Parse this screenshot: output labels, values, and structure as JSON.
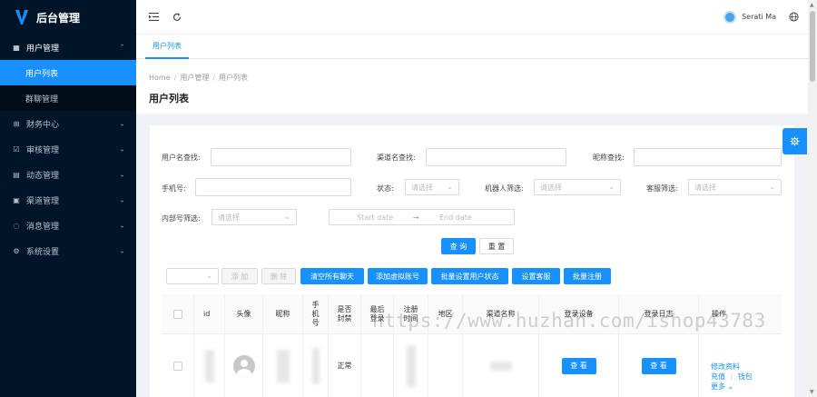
{
  "app": {
    "title": "后台管理"
  },
  "sidebar": {
    "items": [
      {
        "label": "用户管理",
        "icon": "table-icon",
        "open": true,
        "children": [
          {
            "label": "用户列表",
            "active": true
          },
          {
            "label": "群聊管理",
            "active": false
          }
        ]
      },
      {
        "label": "财务中心",
        "icon": "finance-icon"
      },
      {
        "label": "审核管理",
        "icon": "check-icon"
      },
      {
        "label": "动态管理",
        "icon": "feed-icon"
      },
      {
        "label": "渠道管理",
        "icon": "channel-icon"
      },
      {
        "label": "消息管理",
        "icon": "message-icon"
      },
      {
        "label": "系统设置",
        "icon": "gear-icon"
      }
    ]
  },
  "header": {
    "user_name": "Serati Ma"
  },
  "tabs": [
    {
      "label": "用户列表",
      "active": true
    }
  ],
  "breadcrumb": [
    "Home",
    "用户管理",
    "用户列表"
  ],
  "page": {
    "title": "用户列表"
  },
  "filters": {
    "username_label": "用户名查找:",
    "channel_label": "渠道名查找:",
    "nickname_label": "昵称查找:",
    "phone_label": "手机号:",
    "status_label": "状态:",
    "status_placeholder": "请选择",
    "robot_label": "机器人筛选:",
    "robot_placeholder": "请选择",
    "service_label": "客服筛选:",
    "service_placeholder": "请选择",
    "internal_label": "内部号筛选:",
    "internal_placeholder": "请选择",
    "date_start": "Start date",
    "date_end": "End date",
    "search_button": "查 询",
    "reset_button": "重 置"
  },
  "toolbar": {
    "add": "添 加",
    "delete": "删 除",
    "clear_chats": "清空所有聊天",
    "add_virtual": "添加虚拟账号",
    "batch_status": "批量设置用户状态",
    "set_service": "设置客服",
    "batch_register": "批量注册"
  },
  "table": {
    "columns": [
      "id",
      "头像",
      "昵称",
      "手机号",
      "是否封禁",
      "最后登录",
      "注册时间",
      "地区",
      "渠道名称",
      "登录设备",
      "登录日志",
      "操作"
    ],
    "rows": [
      {
        "status": "正常",
        "device_button": "查 看",
        "log_button": "查 看",
        "actions": {
          "edit": "修改资料",
          "recharge": "充值",
          "wallet": "钱包",
          "more": "更多"
        }
      }
    ]
  },
  "watermark": "https://www.huzhan.com/ishop43783",
  "colors": {
    "primary": "#1890ff",
    "sidebar_bg": "#001529"
  }
}
